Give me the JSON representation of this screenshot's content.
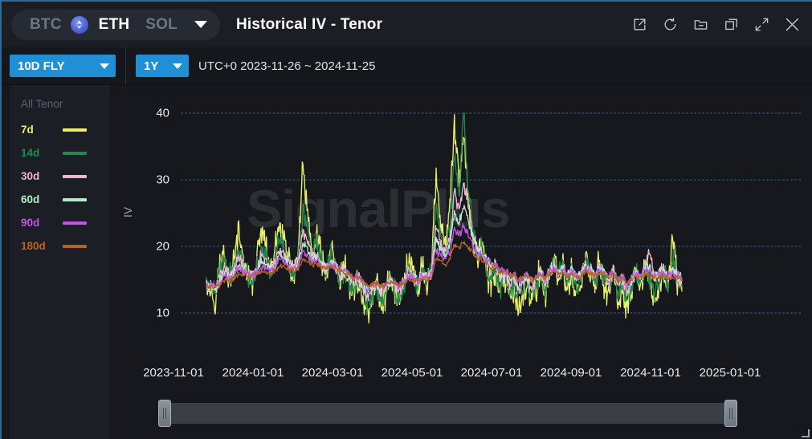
{
  "header": {
    "assets": [
      {
        "label": "BTC",
        "active": false,
        "icon": null
      },
      {
        "label": "ETH",
        "active": true,
        "icon": "eth-token-icon"
      },
      {
        "label": "SOL",
        "active": false,
        "icon": null
      }
    ],
    "asset_dropdown_icon": "chevron-down-icon",
    "title": "Historical IV - Tenor",
    "actions": [
      {
        "name": "external-link-icon",
        "label": "Open in new window"
      },
      {
        "name": "refresh-icon",
        "label": "Refresh"
      },
      {
        "name": "folder-minus-icon",
        "label": "Remove from folder"
      },
      {
        "name": "duplicate-icon",
        "label": "Duplicate"
      },
      {
        "name": "expand-icon",
        "label": "Maximize"
      },
      {
        "name": "close-icon",
        "label": "Close"
      }
    ]
  },
  "toolbar": {
    "product_select": {
      "value": "10D FLY",
      "caret": "chevron-down-icon"
    },
    "period_select": {
      "value": "1Y",
      "caret": "chevron-down-icon"
    },
    "date_range": "UTC+0 2023-11-26 ~ 2024-11-25"
  },
  "legend": {
    "title": "All Tenor",
    "items": [
      {
        "label": "7d",
        "color": "#e8ef6e"
      },
      {
        "label": "14d",
        "color": "#1f8a4c"
      },
      {
        "label": "30d",
        "color": "#efb4d2"
      },
      {
        "label": "60d",
        "color": "#b6ecc6"
      },
      {
        "label": "90d",
        "color": "#c454e6"
      },
      {
        "label": "180d",
        "color": "#b5651d"
      }
    ]
  },
  "watermark": "SignalPlus",
  "range_slider": {
    "left_handle_label": "range-start",
    "right_handle_label": "range-end",
    "start_pct": 0,
    "end_pct": 100
  },
  "chart_data": {
    "type": "line",
    "title": "Historical IV - Tenor",
    "subtitle": "10D FLY",
    "xlabel": "",
    "ylabel": "IV",
    "grid": true,
    "legend_position": "left-sidebar",
    "ylim": [
      4,
      44
    ],
    "yticks": [
      40,
      30,
      20,
      10
    ],
    "xticks": [
      "2023-11-01",
      "2024-01-01",
      "2024-03-01",
      "2024-05-01",
      "2024-07-01",
      "2024-09-01",
      "2024-11-01",
      "2025-01-01"
    ],
    "x_domain": [
      "2023-11-26",
      "2024-11-25"
    ],
    "x_unit": "date (weekly sampled)",
    "series": [
      {
        "name": "7d",
        "color": "#e8ef6e",
        "values": [
          15.5,
          13.2,
          12.4,
          16.8,
          19.1,
          14.6,
          17.3,
          21.6,
          18.2,
          15.4,
          14.1,
          16.9,
          22.4,
          19.8,
          16.2,
          18.9,
          23.1,
          20.6,
          17.1,
          15.2,
          19.4,
          31.8,
          24.2,
          18.6,
          21.3,
          17.8,
          15.1,
          19.7,
          16.4,
          14.2,
          16.8,
          13.9,
          12.6,
          15.3,
          11.8,
          9.4,
          12.2,
          14.6,
          10.9,
          12.8,
          15.7,
          13.1,
          11.4,
          14.8,
          18.2,
          16.3,
          13.6,
          17.1,
          14.2,
          16.8,
          31.2,
          23.4,
          18.9,
          25.6,
          38.4,
          29.1,
          36.8,
          27.3,
          21.4,
          17.6,
          20.8,
          16.2,
          13.8,
          15.9,
          12.4,
          14.7,
          11.9,
          13.2,
          10.6,
          12.1,
          14.8,
          11.3,
          13.6,
          16.2,
          12.8,
          15.4,
          18.9,
          14.1,
          16.7,
          13.2,
          15.8,
          12.4,
          14.1,
          18.6,
          15.2,
          13.9,
          17.4,
          14.6,
          12.1,
          15.8,
          11.4,
          13.7,
          10.2,
          12.9,
          15.6,
          13.1,
          17.8,
          14.2,
          11.6,
          13.4,
          16.1,
          12.8,
          22.4,
          14.6,
          13.2
        ]
      },
      {
        "name": "14d",
        "color": "#1f8a4c",
        "values": [
          14.8,
          13.6,
          12.9,
          15.9,
          18.2,
          15.1,
          16.8,
          19.4,
          17.6,
          15.8,
          14.6,
          16.2,
          20.1,
          18.6,
          16.4,
          17.9,
          21.2,
          19.3,
          17.4,
          15.9,
          18.2,
          25.6,
          22.1,
          18.4,
          19.8,
          17.2,
          15.6,
          18.4,
          16.8,
          15.1,
          16.2,
          14.4,
          13.2,
          14.8,
          12.6,
          10.8,
          12.8,
          14.1,
          11.9,
          13.2,
          14.9,
          13.6,
          12.2,
          14.2,
          16.8,
          15.6,
          14.1,
          16.2,
          14.8,
          16.1,
          26.4,
          21.8,
          18.4,
          23.1,
          33.6,
          27.2,
          41.2,
          28.6,
          22.8,
          18.9,
          19.6,
          17.1,
          15.2,
          16.4,
          13.8,
          15.2,
          13.1,
          14.2,
          12.1,
          13.4,
          15.1,
          12.8,
          14.2,
          16.1,
          13.6,
          15.8,
          17.4,
          15.2,
          16.9,
          14.6,
          16.2,
          13.8,
          15.1,
          17.8,
          16.1,
          14.8,
          17.2,
          15.4,
          13.6,
          16.2,
          12.8,
          14.6,
          11.8,
          13.8,
          16.1,
          14.2,
          17.1,
          15.1,
          13.2,
          14.6,
          16.4,
          13.9,
          18.2,
          15.2,
          14.1
        ]
      },
      {
        "name": "30d",
        "color": "#efb4d2",
        "values": [
          14.2,
          13.8,
          13.4,
          15.2,
          17.1,
          15.4,
          16.2,
          18.1,
          17.2,
          16.1,
          15.2,
          16.1,
          18.6,
          17.8,
          16.6,
          17.4,
          19.8,
          18.6,
          17.4,
          16.4,
          17.8,
          22.4,
          20.6,
          18.2,
          18.9,
          17.4,
          16.2,
          17.9,
          16.9,
          15.8,
          16.1,
          15.1,
          14.2,
          15.2,
          13.6,
          12.2,
          13.4,
          14.2,
          12.8,
          13.6,
          14.8,
          14.1,
          13.2,
          14.4,
          16.1,
          15.4,
          14.6,
          15.8,
          15.1,
          16.2,
          23.1,
          20.4,
          18.6,
          21.2,
          28.4,
          25.1,
          29.6,
          26.2,
          22.1,
          19.4,
          19.1,
          17.8,
          16.2,
          17.1,
          14.9,
          15.8,
          14.2,
          14.9,
          13.2,
          14.1,
          15.2,
          13.8,
          14.8,
          16.2,
          14.6,
          16.1,
          17.2,
          15.8,
          16.8,
          15.2,
          16.4,
          14.8,
          15.6,
          17.2,
          16.4,
          15.4,
          17.1,
          15.9,
          14.6,
          16.4,
          13.8,
          15.1,
          12.9,
          14.6,
          16.2,
          15.1,
          17.4,
          19.6,
          15.2,
          15.8,
          16.8,
          14.8,
          16.2,
          15.6,
          14.8
        ]
      },
      {
        "name": "60d",
        "color": "#b6ecc6",
        "values": [
          14.0,
          13.9,
          13.8,
          14.8,
          16.2,
          15.4,
          15.9,
          17.2,
          16.8,
          16.1,
          15.6,
          16.0,
          17.6,
          17.2,
          16.6,
          17.0,
          18.8,
          18.1,
          17.2,
          16.6,
          17.4,
          20.4,
          19.4,
          18.1,
          18.4,
          17.4,
          16.6,
          17.6,
          17.0,
          16.2,
          16.2,
          15.4,
          14.8,
          15.4,
          14.2,
          13.1,
          13.8,
          14.4,
          13.4,
          14.0,
          14.8,
          14.4,
          13.8,
          14.6,
          15.8,
          15.4,
          14.9,
          15.6,
          15.2,
          16.1,
          21.2,
          19.6,
          18.4,
          20.1,
          25.2,
          23.4,
          26.1,
          24.2,
          21.4,
          19.6,
          19.0,
          18.1,
          16.9,
          17.4,
          15.6,
          16.2,
          15.1,
          15.4,
          14.2,
          14.8,
          15.4,
          14.4,
          15.1,
          16.1,
          15.1,
          16.2,
          16.9,
          16.1,
          16.6,
          15.6,
          16.4,
          15.4,
          15.9,
          16.9,
          16.4,
          15.8,
          16.8,
          16.1,
          15.2,
          16.4,
          14.6,
          15.4,
          13.8,
          14.9,
          16.1,
          15.4,
          17.0,
          16.8,
          15.4,
          15.9,
          16.4,
          15.2,
          16.1,
          15.8,
          15.2
        ]
      },
      {
        "name": "90d",
        "color": "#c454e6",
        "values": [
          14.1,
          14.0,
          14.0,
          14.6,
          15.6,
          15.2,
          15.6,
          16.6,
          16.4,
          16.0,
          15.8,
          16.0,
          17.0,
          16.8,
          16.5,
          16.8,
          18.1,
          17.6,
          17.0,
          16.6,
          17.1,
          19.2,
          18.6,
          17.8,
          18.0,
          17.3,
          16.8,
          17.4,
          17.0,
          16.4,
          16.2,
          15.6,
          15.1,
          15.4,
          14.6,
          13.6,
          14.0,
          14.4,
          13.8,
          14.1,
          14.6,
          14.4,
          14.0,
          14.6,
          15.4,
          15.2,
          14.9,
          15.4,
          15.1,
          15.8,
          19.6,
          18.6,
          18.0,
          19.1,
          22.6,
          21.6,
          22.8,
          21.8,
          20.2,
          19.1,
          18.6,
          18.1,
          17.2,
          17.4,
          16.2,
          16.4,
          15.6,
          15.8,
          14.8,
          15.1,
          15.6,
          14.8,
          15.2,
          16.0,
          15.2,
          16.0,
          16.6,
          16.0,
          16.4,
          15.6,
          16.2,
          15.4,
          15.8,
          16.6,
          16.2,
          15.8,
          16.4,
          16.0,
          15.4,
          16.2,
          14.9,
          15.4,
          14.2,
          15.0,
          15.8,
          15.4,
          16.4,
          16.1,
          15.4,
          15.8,
          16.1,
          15.4,
          15.8,
          15.6,
          15.2
        ]
      },
      {
        "name": "180d",
        "color": "#b5651d",
        "values": [
          13.8,
          13.8,
          13.9,
          14.2,
          14.9,
          14.8,
          15.1,
          15.8,
          15.8,
          15.6,
          15.4,
          15.6,
          16.2,
          16.1,
          16.0,
          16.2,
          17.1,
          16.8,
          16.4,
          16.2,
          16.6,
          18.1,
          17.8,
          17.2,
          17.4,
          16.9,
          16.6,
          17.0,
          16.8,
          16.2,
          16.0,
          15.6,
          15.2,
          15.4,
          14.8,
          14.0,
          14.2,
          14.4,
          14.0,
          14.2,
          14.6,
          14.4,
          14.1,
          14.5,
          15.1,
          15.0,
          14.8,
          15.1,
          14.9,
          15.4,
          18.2,
          17.6,
          17.2,
          18.0,
          20.4,
          19.8,
          20.6,
          19.9,
          18.9,
          18.2,
          17.8,
          17.4,
          16.8,
          17.0,
          16.1,
          16.2,
          15.6,
          15.8,
          15.0,
          15.2,
          15.6,
          15.0,
          15.2,
          15.8,
          15.2,
          15.8,
          16.2,
          15.8,
          16.0,
          15.4,
          15.8,
          15.2,
          15.6,
          16.1,
          15.8,
          15.6,
          16.0,
          15.8,
          15.2,
          15.8,
          14.9,
          15.2,
          14.4,
          14.9,
          15.4,
          15.2,
          15.8,
          15.6,
          15.2,
          15.4,
          15.6,
          15.2,
          15.4,
          15.4,
          15.1
        ]
      }
    ]
  }
}
